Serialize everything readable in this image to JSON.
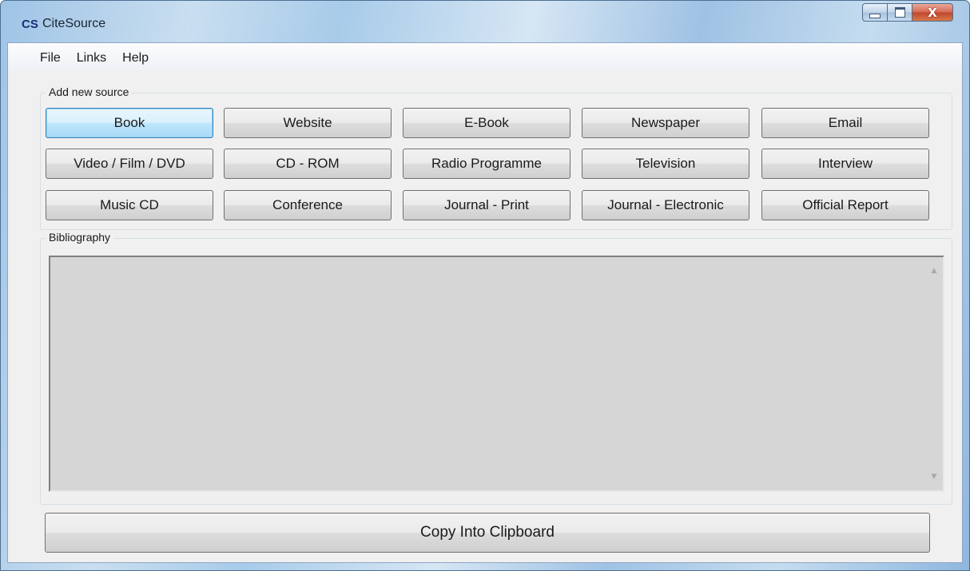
{
  "window": {
    "app_icon_text": "CS",
    "title": "CiteSource",
    "controls": {
      "minimize_icon": "minimize-icon",
      "maximize_icon": "maximize-icon",
      "close_icon": "close-icon",
      "close_glyph": "X"
    }
  },
  "menu": {
    "items": [
      {
        "label": "File"
      },
      {
        "label": "Links"
      },
      {
        "label": "Help"
      }
    ]
  },
  "add_source": {
    "legend": "Add new source",
    "buttons": [
      {
        "label": "Book"
      },
      {
        "label": "Website"
      },
      {
        "label": "E-Book"
      },
      {
        "label": "Newspaper"
      },
      {
        "label": "Email"
      },
      {
        "label": "Video / Film / DVD"
      },
      {
        "label": "CD - ROM"
      },
      {
        "label": "Radio Programme"
      },
      {
        "label": "Television"
      },
      {
        "label": "Interview"
      },
      {
        "label": "Music CD"
      },
      {
        "label": "Conference"
      },
      {
        "label": "Journal - Print"
      },
      {
        "label": "Journal - Electronic"
      },
      {
        "label": "Official Report"
      }
    ]
  },
  "bibliography": {
    "legend": "Bibliography",
    "text": "",
    "scroll_up_icon": "scroll-up-arrow-icon",
    "scroll_down_icon": "scroll-down-arrow-icon"
  },
  "footer": {
    "copy_label": "Copy Into Clipboard"
  },
  "colors": {
    "title_text": "#1b2430",
    "app_icon": "#1a2e78",
    "client_background": "#f0f0f0",
    "bibliography_background": "#d6d6d6",
    "default_button_border": "#3c7fb1"
  }
}
